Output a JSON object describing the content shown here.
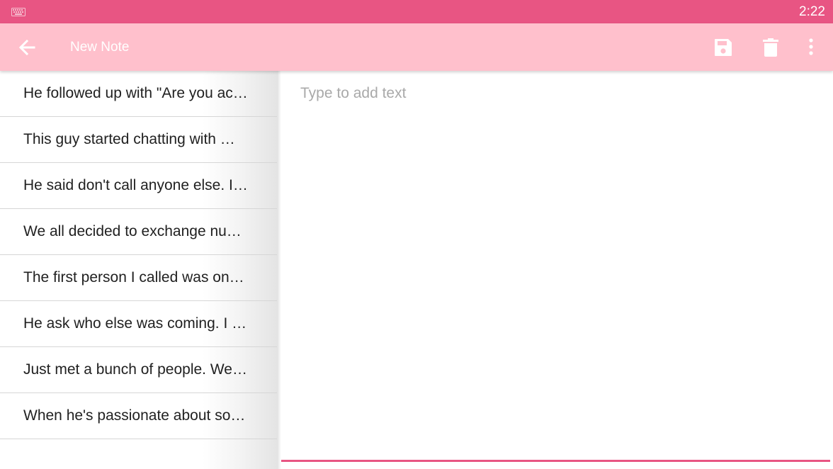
{
  "status_bar": {
    "time": "2:22",
    "keyboard_icon": "keyboard-icon",
    "color": "#e85583"
  },
  "toolbar": {
    "title": "New Note",
    "back_icon": "arrow-back-icon",
    "save_icon": "save-icon",
    "delete_icon": "delete-icon",
    "more_icon": "more-vert-icon",
    "color": "#ffc0cc"
  },
  "notes": [
    {
      "label": "He followed up with \"Are you ac…"
    },
    {
      "label": "This guy started chatting with …"
    },
    {
      "label": "He said don't call anyone else. I…"
    },
    {
      "label": "We all decided to exchange nu…"
    },
    {
      "label": "The first person I called was on…"
    },
    {
      "label": "He ask who else was coming. I …"
    },
    {
      "label": "Just met a bunch of people. We…"
    },
    {
      "label": "When he's passionate about so…"
    }
  ],
  "editor": {
    "placeholder": "Type to add text",
    "value": "",
    "accent": "#e85583"
  }
}
